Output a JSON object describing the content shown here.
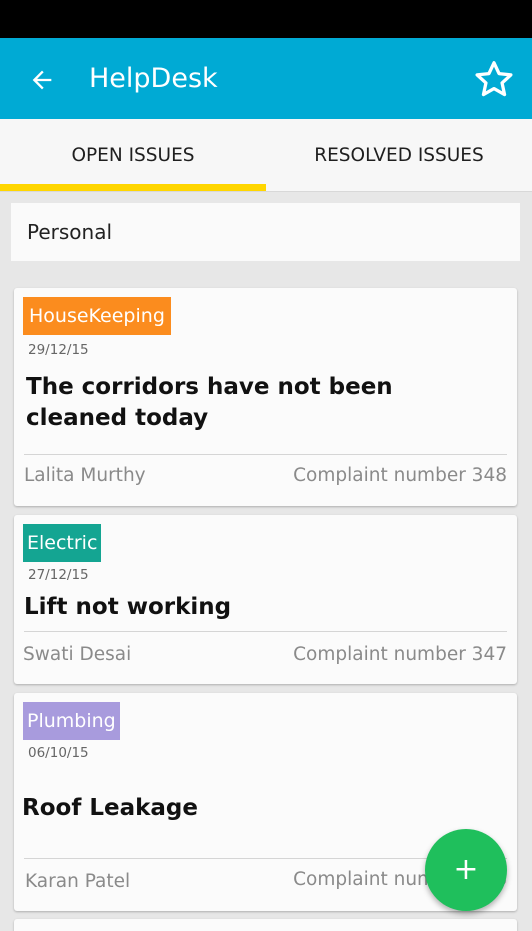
{
  "app": {
    "title": "HelpDesk",
    "colors": {
      "app_bar": "#00aad4",
      "tab_indicator": "#ffd600",
      "fab": "#1fbf5c",
      "status_bar": "#000000"
    },
    "icons": {
      "back": "arrow-left",
      "favorite": "star-outline",
      "add": "plus"
    }
  },
  "tabs": [
    {
      "label": "OPEN ISSUES",
      "selected": true
    },
    {
      "label": "RESOLVED ISSUES",
      "selected": false
    }
  ],
  "filter": {
    "value": "Personal"
  },
  "issues": [
    {
      "category": "HouseKeeping",
      "category_color": "#fb8c1e",
      "date": "29/12/15",
      "title_line1": "The corridors have not been",
      "title_line2": "cleaned today",
      "author": "Lalita Murthy",
      "complaint": "Complaint number 348"
    },
    {
      "category": "Electric",
      "category_color": "#14a592",
      "date": "27/12/15",
      "title_line1": "Lift not working",
      "author": "Swati Desai",
      "complaint": "Complaint number 347"
    },
    {
      "category": "Plumbing",
      "category_color": "#a89bdd",
      "date": "06/10/15",
      "title_line1": "Roof Leakage",
      "author": "Karan Patel",
      "complaint": "Complaint number 346"
    }
  ],
  "fab": {
    "label": "+"
  }
}
